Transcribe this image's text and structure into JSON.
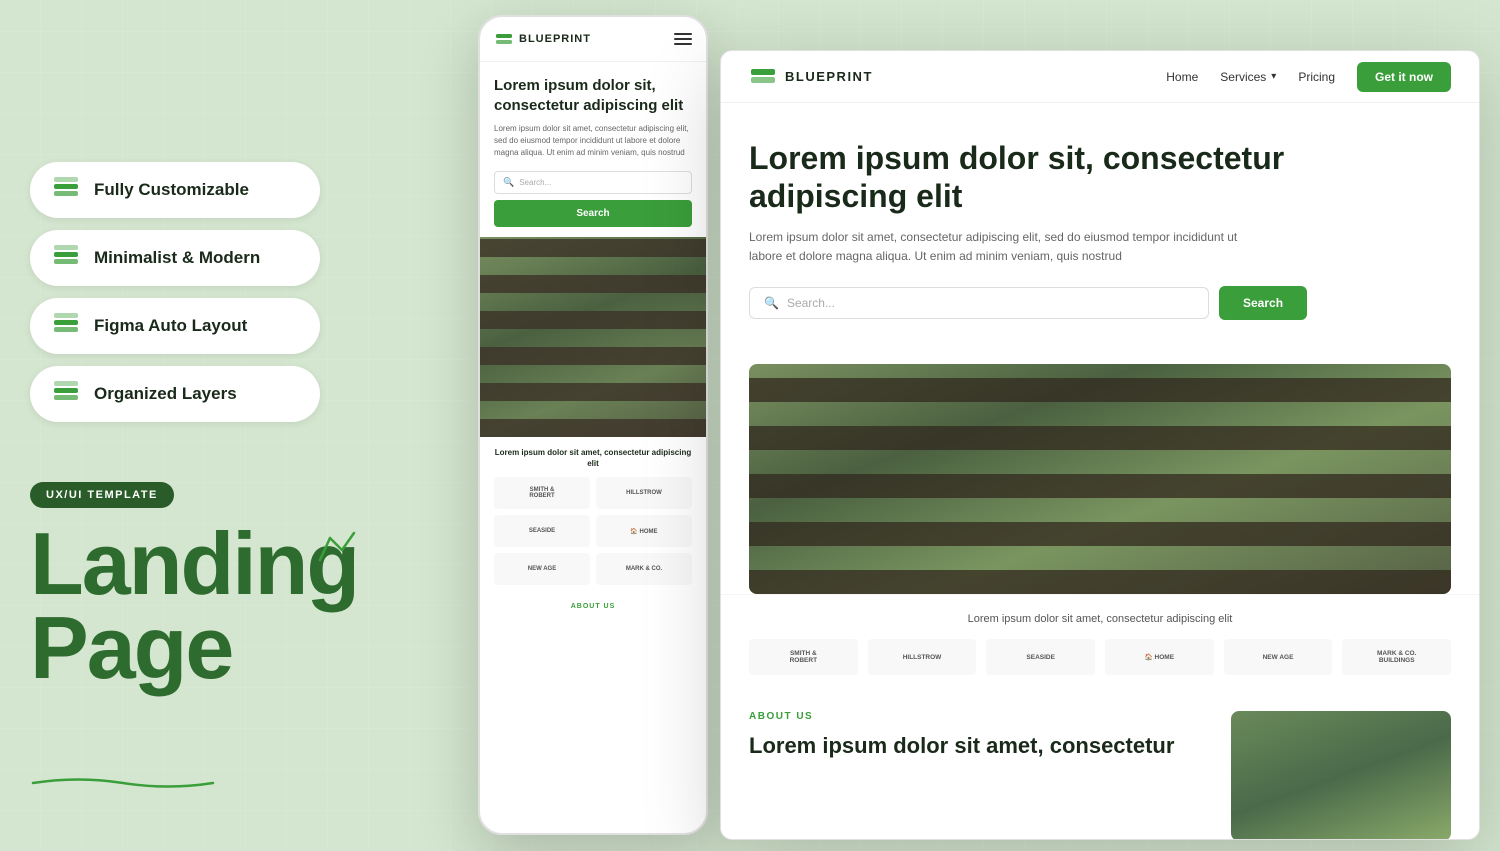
{
  "background": {
    "color": "#d4e6cf"
  },
  "left_panel": {
    "features": [
      {
        "id": "fully-customizable",
        "label": "Fully Customizable",
        "icon": "layers"
      },
      {
        "id": "minimalist-modern",
        "label": "Minimalist & Modern",
        "icon": "layers"
      },
      {
        "id": "figma-auto-layout",
        "label": "Figma Auto Layout",
        "icon": "layers"
      },
      {
        "id": "organized-layers",
        "label": "Organized Layers",
        "icon": "layers"
      }
    ],
    "badge": "UX/UI TEMPLATE",
    "title_line1": "Landing",
    "title_line2": "Page"
  },
  "mobile_mockup": {
    "brand": "BLUEPRINT",
    "hero_title": "Lorem ipsum dolor sit, consectetur adipiscing elit",
    "hero_body": "Lorem ipsum dolor sit amet, consectetur adipiscing elit, sed do eiusmod tempor incididunt ut labore et dolore magna aliqua. Ut enim ad minim veniam, quis nostrud",
    "search_placeholder": "Search...",
    "search_btn": "Search",
    "partners_title": "Lorem ipsum dolor sit amet, consectetur adipiscing elit",
    "about_label": "ABOUT US",
    "logos": [
      {
        "name": "Smith & Robert"
      },
      {
        "name": "Hillstrow"
      },
      {
        "name": "Seaside"
      },
      {
        "name": "Home"
      },
      {
        "name": "New Age"
      },
      {
        "name": "Mark & Co."
      }
    ]
  },
  "desktop_mockup": {
    "brand": "BLUEPRINT",
    "nav_links": [
      "Home",
      "Services",
      "Pricing"
    ],
    "services_dropdown": true,
    "cta_btn": "Get it now",
    "hero_title": "Lorem ipsum dolor sit, consectetur adipiscing elit",
    "hero_body": "Lorem ipsum dolor sit amet, consectetur adipiscing elit, sed do eiusmod tempor incididunt ut labore et dolore magna aliqua. Ut enim ad minim veniam, quis nostrud",
    "search_placeholder": "Search...",
    "search_btn": "Search",
    "partners_title": "Lorem ipsum dolor sit amet, consectetur adipiscing elit",
    "about_badge": "ABOUT US",
    "about_title": "Lorem ipsum dolor sit amet, consectetur",
    "logos": [
      {
        "name": "Smith & Robert"
      },
      {
        "name": "Hillstrow"
      },
      {
        "name": "Seaside"
      },
      {
        "name": "Home"
      },
      {
        "name": "New Age"
      },
      {
        "name": "Mark & Co. Buildings"
      }
    ]
  }
}
